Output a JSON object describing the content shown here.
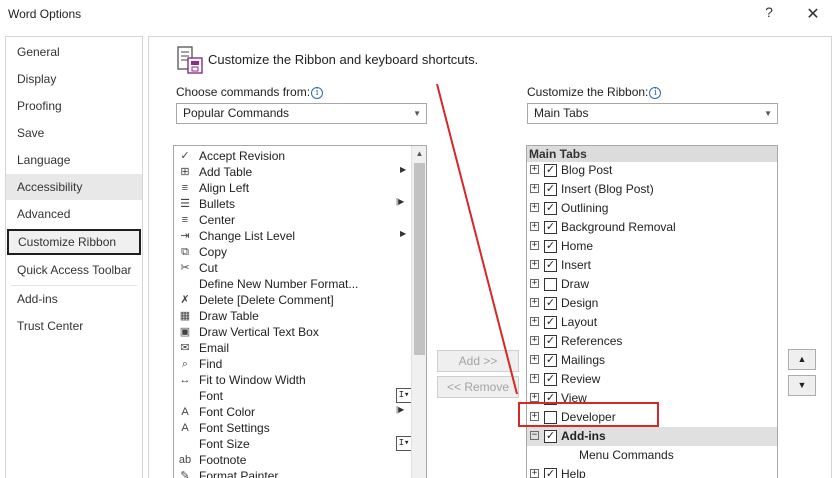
{
  "window": {
    "title": "Word Options",
    "help_glyph": "?",
    "close_glyph": "✕"
  },
  "sidebar": {
    "items": [
      {
        "label": "General"
      },
      {
        "label": "Display"
      },
      {
        "label": "Proofing"
      },
      {
        "label": "Save"
      },
      {
        "label": "Language"
      },
      {
        "label": "Accessibility"
      },
      {
        "label": "Advanced"
      },
      {
        "label": "Customize Ribbon"
      },
      {
        "label": "Quick Access Toolbar"
      },
      {
        "label": "Add-ins"
      },
      {
        "label": "Trust Center"
      }
    ]
  },
  "header": {
    "text": "Customize the Ribbon and keyboard shortcuts."
  },
  "left": {
    "label": "Choose commands from:",
    "dropdown_value": "Popular Commands",
    "commands": [
      {
        "label": "Accept Revision",
        "icon": "accept-revision-icon",
        "glyph": "✓"
      },
      {
        "label": "Add Table",
        "icon": "table-icon",
        "glyph": "⊞"
      },
      {
        "label": "Align Left",
        "icon": "align-left-icon",
        "glyph": "≡"
      },
      {
        "label": "Bullets",
        "icon": "bullets-icon",
        "glyph": "☰"
      },
      {
        "label": "Center",
        "icon": "center-icon",
        "glyph": "≡"
      },
      {
        "label": "Change List Level",
        "icon": "list-level-icon",
        "glyph": "⇥"
      },
      {
        "label": "Copy",
        "icon": "copy-icon",
        "glyph": "⧉"
      },
      {
        "label": "Cut",
        "icon": "scissors-icon",
        "glyph": "✂"
      },
      {
        "label": "Define New Number Format...",
        "icon": "blank-icon",
        "glyph": ""
      },
      {
        "label": "Delete [Delete Comment]",
        "icon": "delete-comment-icon",
        "glyph": "✗"
      },
      {
        "label": "Draw Table",
        "icon": "draw-table-icon",
        "glyph": "▦"
      },
      {
        "label": "Draw Vertical Text Box",
        "icon": "vertical-text-box-icon",
        "glyph": "▣"
      },
      {
        "label": "Email",
        "icon": "email-icon",
        "glyph": "✉"
      },
      {
        "label": "Find",
        "icon": "find-icon",
        "glyph": "⌕"
      },
      {
        "label": "Fit to Window Width",
        "icon": "fit-width-icon",
        "glyph": "↔"
      },
      {
        "label": "Font",
        "icon": "blank-icon",
        "glyph": ""
      },
      {
        "label": "Font Color",
        "icon": "font-color-icon",
        "glyph": "A"
      },
      {
        "label": "Font Settings",
        "icon": "font-settings-icon",
        "glyph": "A"
      },
      {
        "label": "Font Size",
        "icon": "blank-icon",
        "glyph": ""
      },
      {
        "label": "Footnote",
        "icon": "footnote-icon",
        "glyph": "ab"
      },
      {
        "label": "Format Painter",
        "icon": "format-painter-icon",
        "glyph": "✎"
      }
    ],
    "add_button": "Add >>",
    "remove_button": "<< Remove"
  },
  "right": {
    "label": "Customize the Ribbon:",
    "dropdown_value": "Main Tabs",
    "header": "Main Tabs",
    "tabs": [
      {
        "label": "Blog Post",
        "checked": true
      },
      {
        "label": "Insert (Blog Post)",
        "checked": true
      },
      {
        "label": "Outlining",
        "checked": true
      },
      {
        "label": "Background Removal",
        "checked": true
      },
      {
        "label": "Home",
        "checked": true
      },
      {
        "label": "Insert",
        "checked": true
      },
      {
        "label": "Draw",
        "checked": false
      },
      {
        "label": "Design",
        "checked": true
      },
      {
        "label": "Layout",
        "checked": true
      },
      {
        "label": "References",
        "checked": true
      },
      {
        "label": "Mailings",
        "checked": true
      },
      {
        "label": "Review",
        "checked": true
      },
      {
        "label": "View",
        "checked": true
      },
      {
        "label": "Developer",
        "checked": false
      },
      {
        "label": "Add-ins",
        "checked": true,
        "expanded": true
      },
      {
        "label": "Menu Commands",
        "child": true
      },
      {
        "label": "Help",
        "checked": true
      }
    ],
    "move_up_glyph": "▲",
    "move_down_glyph": "▼"
  },
  "colors": {
    "highlight": "#d62828",
    "info_accent": "#2b6cb0"
  }
}
